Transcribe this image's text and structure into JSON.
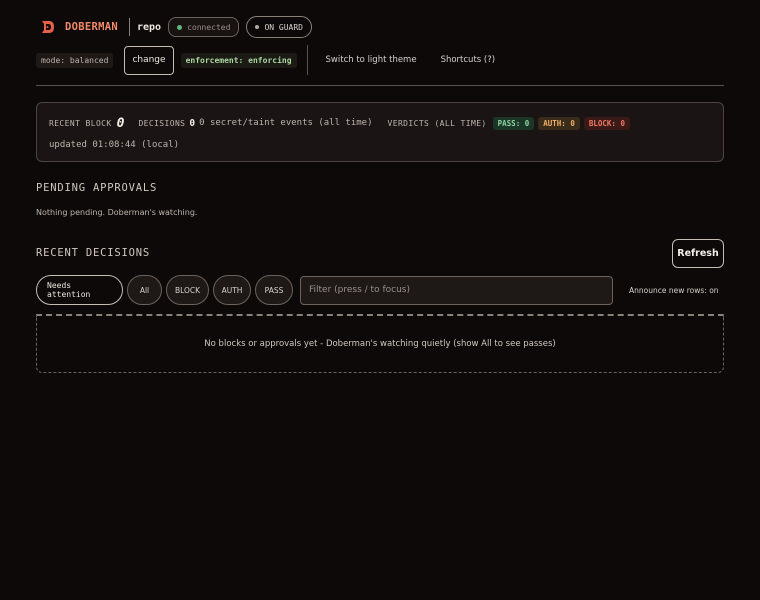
{
  "header": {
    "brand": "DOBERMAN",
    "repo": "repo",
    "connection_status": "connected",
    "guard_status": "ON GUARD",
    "mode_tag": "mode: balanced",
    "change_label": "change",
    "enforcement_tag": "enforcement: enforcing",
    "theme_link": "Switch to light theme",
    "shortcuts_link": "Shortcuts (?)"
  },
  "status": {
    "recent_block_label": "RECENT BLOCK",
    "recent_block_value": "0",
    "decisions_label": "DECISIONS",
    "decisions_value": "0",
    "events_text": "0 secret/taint events (all time)",
    "verdicts_label": "VERDICTS (ALL TIME)",
    "pass_badge": "PASS: 0",
    "auth_badge": "AUTH: 0",
    "block_badge": "BLOCK: 0",
    "updated_text": "updated 01:08:44 (local)"
  },
  "pending": {
    "title": "PENDING APPROVALS",
    "empty_text": "Nothing pending. Doberman's watching."
  },
  "recent": {
    "title": "RECENT DECISIONS",
    "refresh_label": "Refresh",
    "filters": [
      "Needs attention",
      "All",
      "BLOCK",
      "AUTH",
      "PASS"
    ],
    "filter_placeholder": "Filter (press / to focus)",
    "announce_text": "Announce new rows: on",
    "empty_text": "No blocks or approvals yet - Doberman's watching quietly (show All to see passes)"
  },
  "colors": {
    "brand": "#f08a6a",
    "connected_dot": "#5fb87a",
    "pass": "#8fd4a6",
    "auth": "#f0b06a",
    "block": "#f07a68"
  }
}
